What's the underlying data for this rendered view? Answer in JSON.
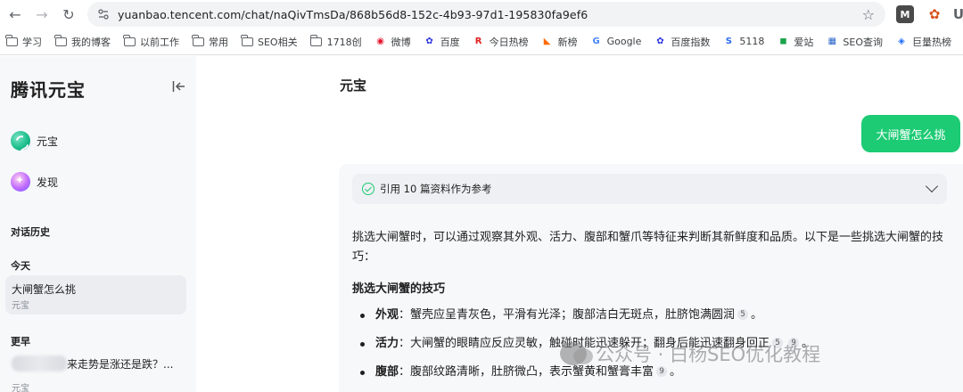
{
  "browser": {
    "url": "yuanbao.tencent.com/chat/naQivTmsDa/868b56d8-152c-4b93-97d1-195830fa9ef6",
    "extension_m_label": "M",
    "extension_u_label": "U"
  },
  "bookmarks": [
    {
      "label": "学习",
      "icon": "folder-icon"
    },
    {
      "label": "我的博客",
      "icon": "folder-icon"
    },
    {
      "label": "以前工作",
      "icon": "folder-icon"
    },
    {
      "label": "常用",
      "icon": "folder-icon"
    },
    {
      "label": "SEO相关",
      "icon": "folder-icon"
    },
    {
      "label": "1718创",
      "icon": "folder-icon"
    },
    {
      "label": "微博",
      "icon": "weibo-icon",
      "glyph": "◉",
      "color": "#e6162d"
    },
    {
      "label": "百度",
      "icon": "baidu-paw-icon",
      "glyph": "✿",
      "color": "#2932e1"
    },
    {
      "label": "今日热榜",
      "icon": "r-logo-icon",
      "glyph": "R",
      "color": "#e02020"
    },
    {
      "label": "新榜",
      "icon": "xinbang-icon",
      "glyph": "◣",
      "color": "#ff6a00"
    },
    {
      "label": "Google",
      "icon": "google-icon",
      "glyph": "G",
      "color": "#4285f4"
    },
    {
      "label": "百度指数",
      "icon": "baidu-paw-icon",
      "glyph": "✿",
      "color": "#2932e1"
    },
    {
      "label": "5118",
      "icon": "s-logo-icon",
      "glyph": "S",
      "color": "#2b6de8"
    },
    {
      "label": "爱站",
      "icon": "aizhan-icon",
      "glyph": "◼",
      "color": "#1aa34a"
    },
    {
      "label": "SEO查询",
      "icon": "seo-tool-icon",
      "glyph": "▦",
      "color": "#2a64c8"
    },
    {
      "label": "巨量热榜",
      "icon": "juliang-icon",
      "glyph": "◈",
      "color": "#1e6cff"
    }
  ],
  "sidebar": {
    "brand": "腾讯元宝",
    "nav": [
      {
        "label": "元宝"
      },
      {
        "label": "发现"
      }
    ],
    "history_heading": "对话历史",
    "today_label": "今天",
    "active_conversation": {
      "title": "大闸蟹怎么挑",
      "subtitle": "元宝"
    },
    "earlier_label": "更早",
    "earlier_conversation": {
      "title": "来走势是涨还是跌？...",
      "subtitle": "元宝"
    }
  },
  "main": {
    "title": "元宝",
    "user_message": "大闸蟹怎么挑",
    "references_text": "引用 10 篇资料作为参考",
    "intro": "挑选大闸蟹时，可以通过观察其外观、活力、腹部和蟹爪等特征来判断其新鲜度和品质。以下是一些挑选大闸蟹的技巧：",
    "section_heading": "挑选大闸蟹的技巧",
    "bullets": [
      {
        "key": "外观",
        "text": "：蟹壳应呈青灰色，平滑有光泽；腹部洁白无斑点，肚脐饱满圆润",
        "cites": [
          "5"
        ],
        "tail": "。"
      },
      {
        "key": "活力",
        "text": "：大闸蟹的眼睛应反应灵敏，触碰时能迅速躲开；翻身后能迅速翻身回正",
        "cites": [
          "5",
          "9"
        ],
        "tail": "。"
      },
      {
        "key": "腹部",
        "text": "：腹部纹路清晰，肚脐微凸，表示蟹黄和蟹膏丰富",
        "cites": [
          "9"
        ],
        "tail": "。"
      }
    ]
  },
  "watermark": {
    "text": "公众号 · 白杨SEO优化教程"
  },
  "colors": {
    "accent_green": "#1ccb74",
    "sidebar_bg": "#f7f8fa",
    "card_bg": "#f7f8fa"
  }
}
